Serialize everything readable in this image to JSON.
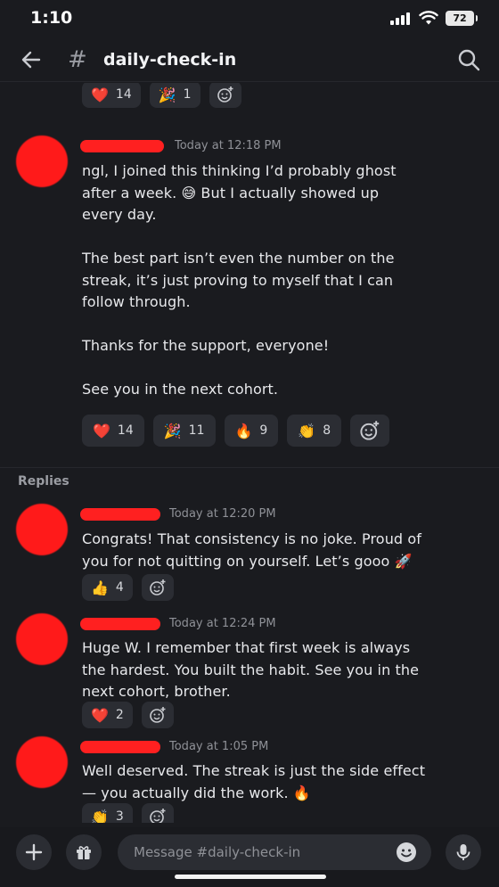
{
  "status": {
    "time": "1:10",
    "battery": "72"
  },
  "header": {
    "channel": "daily-check-in"
  },
  "top_reactions": [
    {
      "emoji": "❤️",
      "count": "14"
    },
    {
      "emoji": "🎉",
      "count": "1"
    }
  ],
  "main_message": {
    "timestamp": "Today at 12:18 PM",
    "paragraphs": [
      "ngl, I joined this thinking I’d probably ghost after a week. 😅 But I actually showed up every day.",
      "The best part isn’t even the number on the streak, it’s just proving to myself that I can follow through.",
      "Thanks for the support, everyone!",
      "See you in the next cohort."
    ],
    "reactions": [
      {
        "emoji": "❤️",
        "count": "14"
      },
      {
        "emoji": "🎉",
        "count": "11"
      },
      {
        "emoji": "🔥",
        "count": "9"
      },
      {
        "emoji": "👏",
        "count": "8"
      }
    ]
  },
  "replies_label": "Replies",
  "replies": [
    {
      "timestamp": "Today at 12:20 PM",
      "text": "Congrats! That consistency is no joke. Proud of you for not quitting on yourself. Let’s gooo 🚀",
      "reactions": [
        {
          "emoji": "👍",
          "count": "4"
        }
      ]
    },
    {
      "timestamp": "Today at 12:24 PM",
      "text": "Huge W. I remember that first week is always the hardest. You built the habit. See you in the next cohort, brother.",
      "reactions": [
        {
          "emoji": "❤️",
          "count": "2"
        }
      ]
    },
    {
      "timestamp": "Today at 1:05 PM",
      "text": "Well deserved. The streak is just the side effect — you actually did the work. 🔥",
      "reactions": [
        {
          "emoji": "👏",
          "count": "3"
        }
      ]
    }
  ],
  "composer": {
    "placeholder": "Message #daily-check-in"
  },
  "icons": {
    "back": "arrow-left-icon",
    "hash": "hash-icon",
    "search": "search-icon",
    "add_reaction": "add-reaction-icon",
    "plus": "plus-icon",
    "gift": "gift-icon",
    "emoji": "emoji-icon",
    "mic": "microphone-icon"
  }
}
